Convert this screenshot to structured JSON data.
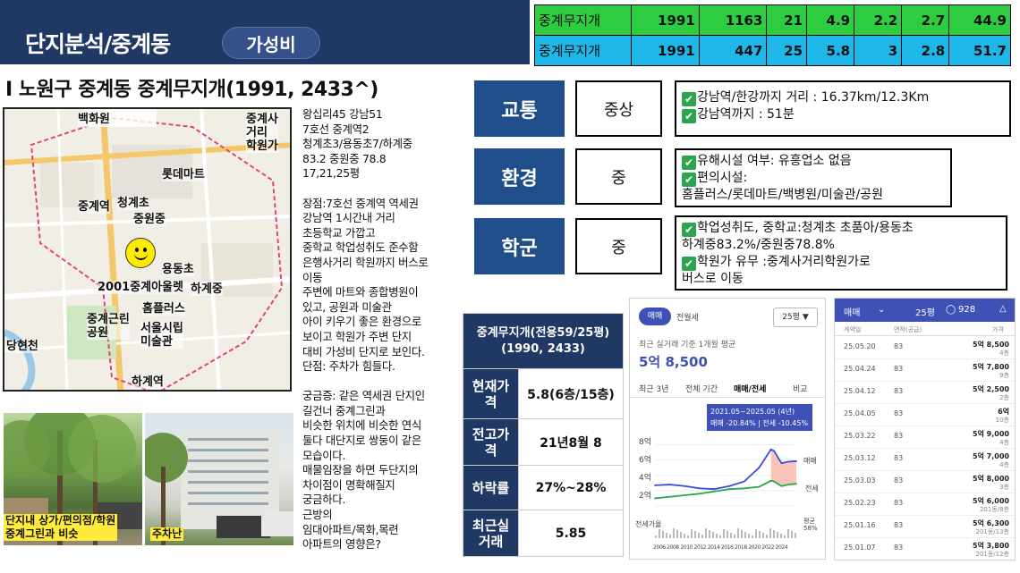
{
  "header": {
    "title": "단지분석/중계동",
    "pill": "가성비"
  },
  "top_table": {
    "rows": [
      {
        "name": "중계무지개",
        "v1": "1991",
        "v2": "1163",
        "v3": "21",
        "v4": "4.9",
        "v5": "2.2",
        "v6": "2.7",
        "v7": "44.9"
      },
      {
        "name": "중계무지개",
        "v1": "1991",
        "v2": "447",
        "v3": "25",
        "v4": "5.8",
        "v5": "3",
        "v6": "2.8",
        "v7": "51.7"
      }
    ],
    "colors": {
      "row1": "#2ecc40",
      "row2": "#1fb6e8"
    }
  },
  "page_title": "I 노원구 중계동 중계무지개(1991, 2433^)",
  "map": {
    "labels": {
      "baekhwawon": "백화원",
      "junggyesa": "중계사\n거리\n학원가",
      "lottemart": "롯데마트",
      "junggyeyeok": "중계역",
      "cheonggyecho": "청계초",
      "eunbongjung": "중원중",
      "yongdongcho": "용동초",
      "apt2001": "2001중계아울렛",
      "hagyejung": "하계중",
      "homeplus": "홈플러스",
      "park": "중계근린\n공원",
      "museum": "서울시립\n미술관",
      "danghyeoncheon": "당현천",
      "hagyeyeok": "하계역"
    }
  },
  "photos": {
    "caption1": "단지내 상가/편의점/학원\n중계그린과 비슷",
    "caption2": "주차난"
  },
  "mid_text": "왕십리45 강남51\n7호선 중계역2\n청계초3/용동초7/하계중\n83.2 중원중 78.8\n17,21,25평\n\n장점:7호선 중계역 역세권\n강남역 1시간내 거리\n초등학교 가깝고\n중학교 학업성취도 준수함\n은행사거리 학원까지 버스로\n이동\n주변에 마트와 종합병원이\n있고, 공원과 미술관\n아이 키우기 좋은 환경으로\n보이고 학원가 주변 단지\n대비 가성비 단지로 보인다.\n단점: 주차가 힘들다.\n\n궁금증: 같은 역세권 단지인\n길건너 중계그린과\n비슷한 위치에 비슷한 연식\n둘다 대단지로 쌍둥이 같은\n모습이다.\n매물임장을 하면 두단지의\n차이점이 명확해질지\n궁금하다.\n근방의\n임대아파트/목화,목련\n아파트의 영향은?",
  "ratings": [
    {
      "label": "교통",
      "grade": "중상",
      "lines": [
        "강남역/한강까지 거리 : 16.37km/12.3Km",
        "강남역까지 : 51분"
      ],
      "checks": [
        true,
        true
      ]
    },
    {
      "label": "환경",
      "grade": "중",
      "lines": [
        "유해시설 여부: 유흥업소 없음",
        "편의시설:",
        "홈플러스/롯데마트/백병원/미술관/공원"
      ],
      "checks": [
        true,
        true,
        false
      ]
    },
    {
      "label": "학군",
      "grade": "중",
      "lines": [
        "학업성취도, 중학교:청계초 초품아/용동초",
        "하계중83.2%/중원중78.8%",
        "학원가 유무 :중계사거리학원가로",
        "버스로 이동"
      ],
      "checks": [
        true,
        false,
        true,
        false
      ]
    }
  ],
  "info_table": {
    "header": "중계무지개(전용59/25평)\n(1990, 2433)",
    "rows": [
      {
        "label": "현재가\n격",
        "value": "5.8(6층/15층)"
      },
      {
        "label": "전고가\n격",
        "value": "21년8월 8"
      },
      {
        "label": "하락률",
        "value": "27%~28%"
      },
      {
        "label": "최근실\n거래",
        "value": "5.85"
      }
    ]
  },
  "shot1": {
    "tab1": "매매",
    "tab2": "전월세",
    "size": "25평 ▼",
    "subtitle": "최근 실거래 기준 1개월 평균",
    "price": "5억 8,500",
    "periods": [
      "최근 3년",
      "전체 기간",
      "매매/전세",
      "비교"
    ],
    "tooltip1": "2021.05~2025.05 (4년)",
    "tooltip2": "매매 -20.84% | 전세 -10.45%",
    "y_ticks": [
      "8억",
      "6억",
      "4억",
      "2억"
    ],
    "x_ticks": "2006 2008 2010 2012 2014 2016 2018 2020 2022 2024",
    "legend_sale": "매매",
    "legend_rent": "전세",
    "vol_label": "전세가율",
    "vol_value": "평균\n58%",
    "chart_data": {
      "type": "line",
      "x": [
        2006,
        2008,
        2010,
        2012,
        2014,
        2016,
        2018,
        2020,
        2021.6,
        2022,
        2023,
        2024,
        2025
      ],
      "series": [
        {
          "name": "매매",
          "values": [
            2.7,
            2.8,
            2.6,
            2.3,
            2.2,
            2.6,
            3.2,
            5.0,
            7.4,
            7.2,
            5.6,
            5.8,
            5.85
          ]
        },
        {
          "name": "전세",
          "values": [
            1.0,
            1.2,
            1.4,
            1.6,
            1.9,
            2.2,
            2.3,
            2.5,
            3.3,
            3.2,
            2.6,
            2.8,
            2.9
          ]
        }
      ],
      "colors": {
        "sale": "#3a4ed8",
        "rent": "#2aa84a",
        "fill": "#f7b5a8"
      },
      "ylim": [
        0,
        9
      ]
    }
  },
  "shot2": {
    "tab": "매매",
    "size": "25평",
    "count": "928",
    "cols": [
      "계약일",
      "면적(공급)",
      "가격"
    ],
    "rows": [
      {
        "date": "25.05.20",
        "area": "83",
        "price": "5억 8,500",
        "floor": "4층"
      },
      {
        "date": "25.04.24",
        "area": "83",
        "price": "5억 7,800",
        "floor": "9층"
      },
      {
        "date": "25.04.12",
        "area": "83",
        "price": "5억 2,500",
        "floor": "2층"
      },
      {
        "date": "25.04.05",
        "area": "83",
        "price": "6억",
        "floor": "10층"
      },
      {
        "date": "25.03.22",
        "area": "83",
        "price": "5억 9,000",
        "floor": "4층"
      },
      {
        "date": "25.03.12",
        "area": "83",
        "price": "5억 7,000",
        "floor": "4층"
      },
      {
        "date": "25.03.03",
        "area": "83",
        "price": "5억 8,000",
        "floor": "3층"
      },
      {
        "date": "25.02.23",
        "area": "83",
        "price": "5억 6,000",
        "floor": "201동/8층"
      },
      {
        "date": "25.01.16",
        "area": "83",
        "price": "5억 6,300",
        "floor": "201동/13층"
      },
      {
        "date": "25.01.07",
        "area": "83",
        "price": "5억 3,800",
        "floor": "201동/12층"
      }
    ]
  }
}
